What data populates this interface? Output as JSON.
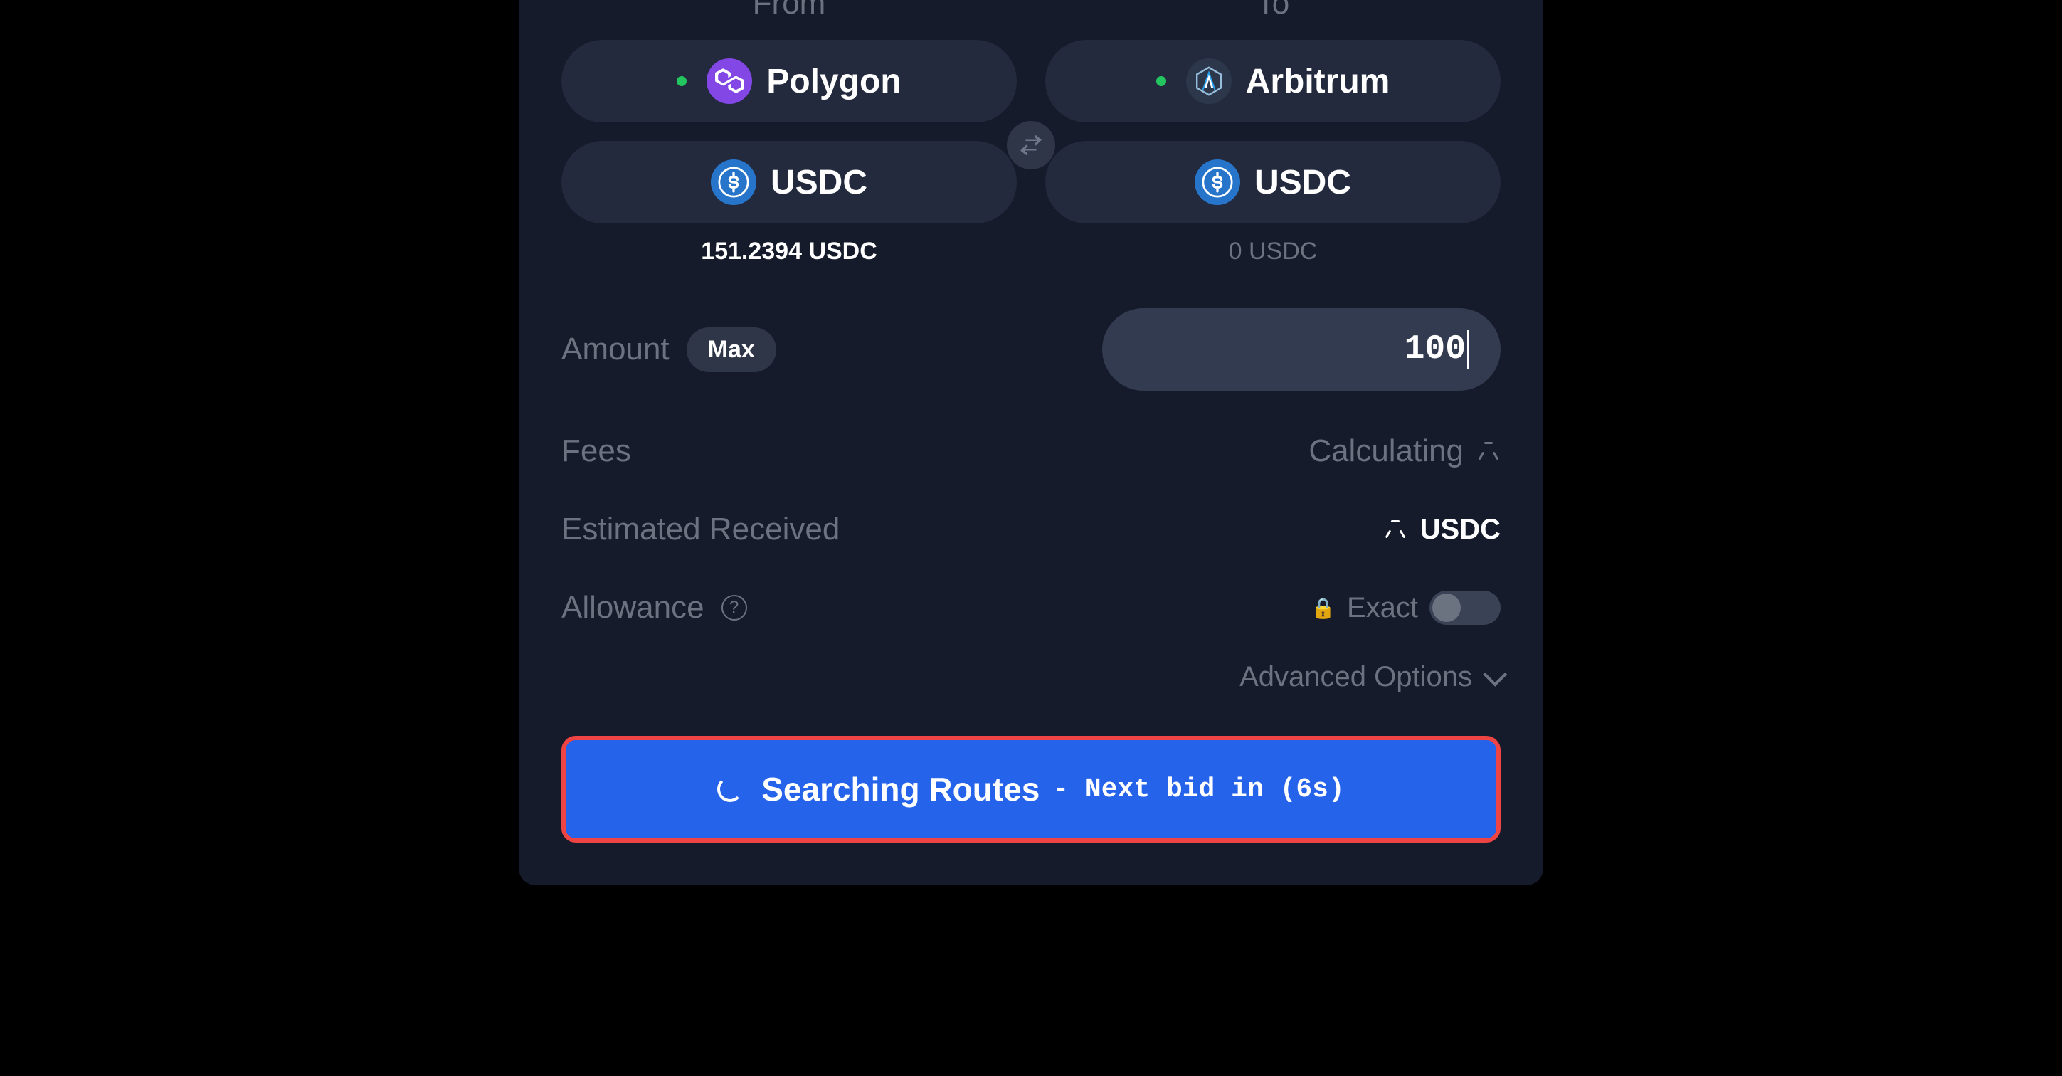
{
  "from": {
    "header": "From",
    "chain": "Polygon",
    "token": "USDC",
    "balance": "151.2394 USDC"
  },
  "to": {
    "header": "To",
    "chain": "Arbitrum",
    "token": "USDC",
    "balance": "0 USDC"
  },
  "amount": {
    "label": "Amount",
    "max_label": "Max",
    "value": "100"
  },
  "fees": {
    "label": "Fees",
    "value": "Calculating"
  },
  "estimated": {
    "label": "Estimated Received",
    "suffix": "USDC"
  },
  "allowance": {
    "label": "Allowance",
    "exact_label": "Exact"
  },
  "advanced_label": "Advanced Options",
  "button": {
    "main": "Searching Routes",
    "sub": "- Next bid in (6s)"
  }
}
